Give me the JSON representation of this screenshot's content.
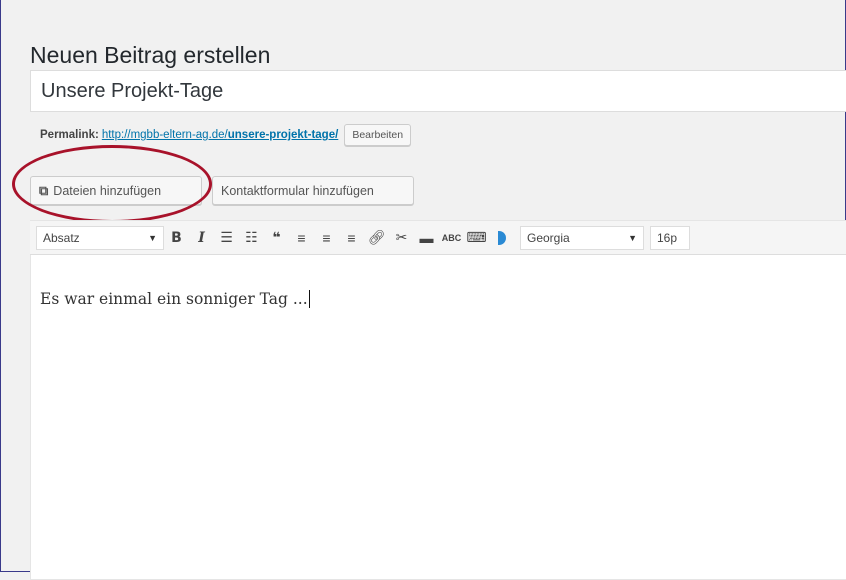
{
  "page_title": "Neuen Beitrag erstellen",
  "post_title": "Unsere Projekt-Tage",
  "permalink": {
    "label": "Permalink:",
    "url_base": "http://mgbb-eltern-ag.de/",
    "slug": "unsere-projekt-tage/",
    "edit_button": "Bearbeiten"
  },
  "media_buttons": {
    "add_media": "Dateien hinzufügen",
    "add_contact_form": "Kontaktformular hinzufügen"
  },
  "toolbar": {
    "format_select": "Absatz",
    "bold": "B",
    "italic": "I",
    "font_select": "Georgia",
    "size_select": "16p",
    "spellcheck": "ABC"
  },
  "icons": {
    "add_media": "media-icon",
    "format_arrow": "chevron-down-icon"
  },
  "editor": {
    "content": "Es war einmal ein sonniger Tag ..."
  },
  "colors": {
    "link": "#0073aa",
    "highlight_circle": "#a8122a"
  }
}
